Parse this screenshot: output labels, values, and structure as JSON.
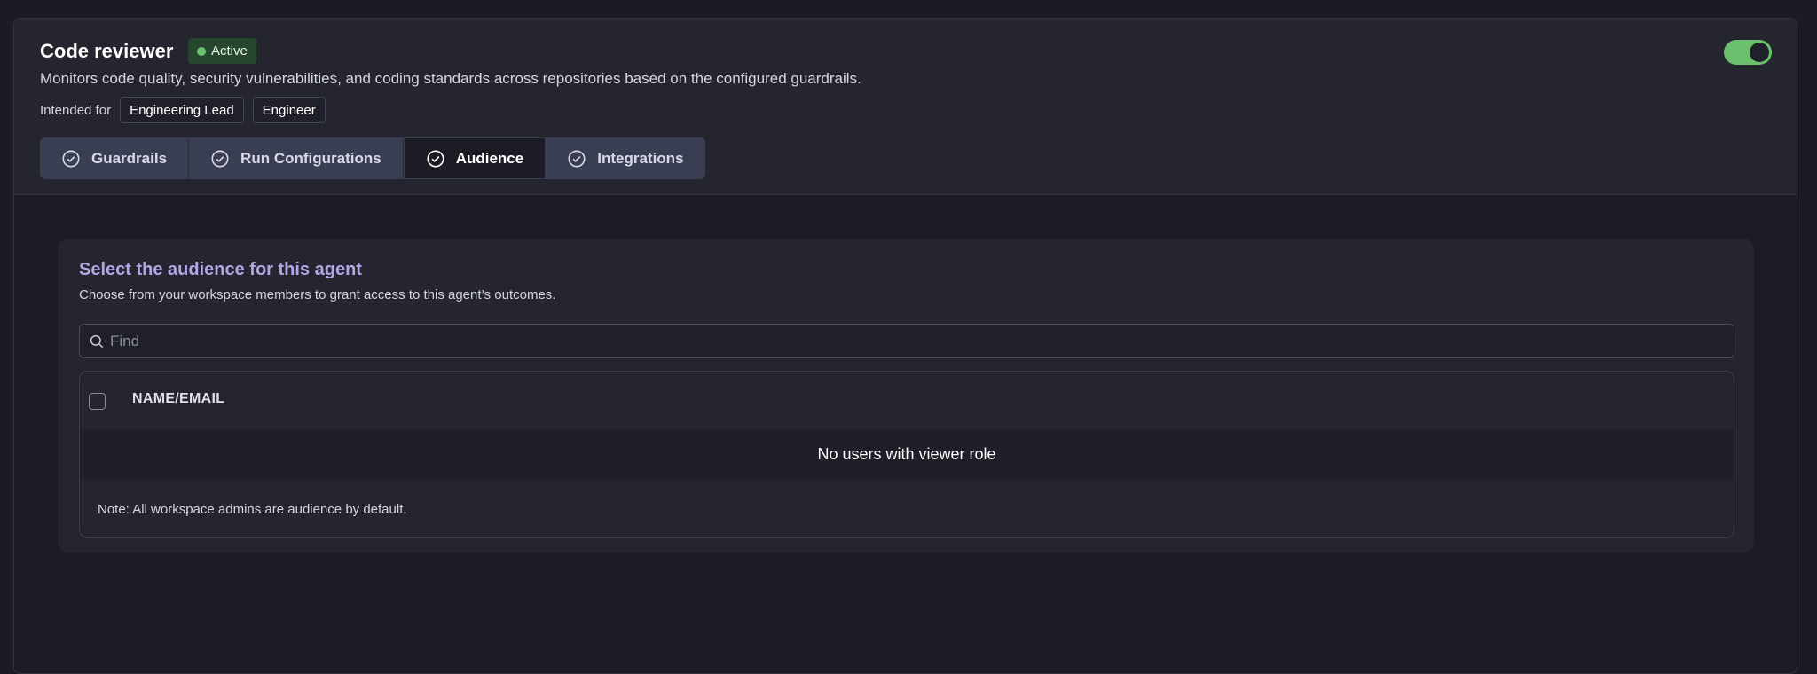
{
  "agent": {
    "title": "Code reviewer",
    "status": "Active",
    "description": "Monitors code quality, security vulnerabilities, and coding standards across repositories based on the configured guardrails.",
    "intended_label": "Intended for",
    "audience_tags": [
      "Engineering Lead",
      "Engineer"
    ],
    "enabled": true
  },
  "tabs": [
    {
      "label": "Guardrails",
      "icon": "check-circle-icon",
      "active": false
    },
    {
      "label": "Run Configurations",
      "icon": "check-circle-icon",
      "active": false
    },
    {
      "label": "Audience",
      "icon": "check-circle-icon",
      "active": true
    },
    {
      "label": "Integrations",
      "icon": "check-circle-icon",
      "active": false
    }
  ],
  "audience": {
    "title": "Select the audience for this agent",
    "subtitle": "Choose from your workspace members to grant access to this agent’s outcomes.",
    "search_placeholder": "Find",
    "search_value": "",
    "column_header": "NAME/EMAIL",
    "empty_message": "No users with viewer role",
    "note": "Note: All workspace admins are audience by default."
  },
  "colors": {
    "accent": "#b0a7e4",
    "status_green": "#6cc36e",
    "toggle_on": "#6cbf6c",
    "background": "#1b1b23"
  }
}
